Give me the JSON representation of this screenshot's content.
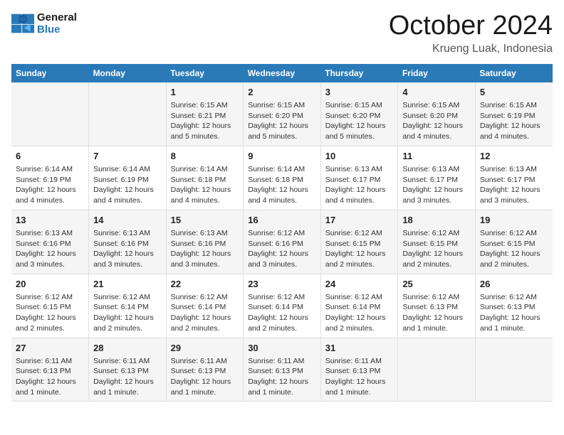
{
  "logo": {
    "line1": "General",
    "line2": "Blue"
  },
  "title": "October 2024",
  "location": "Krueng Luak, Indonesia",
  "weekdays": [
    "Sunday",
    "Monday",
    "Tuesday",
    "Wednesday",
    "Thursday",
    "Friday",
    "Saturday"
  ],
  "weeks": [
    [
      {
        "day": "",
        "info": ""
      },
      {
        "day": "",
        "info": ""
      },
      {
        "day": "1",
        "info": "Sunrise: 6:15 AM\nSunset: 6:21 PM\nDaylight: 12 hours and 5 minutes."
      },
      {
        "day": "2",
        "info": "Sunrise: 6:15 AM\nSunset: 6:20 PM\nDaylight: 12 hours and 5 minutes."
      },
      {
        "day": "3",
        "info": "Sunrise: 6:15 AM\nSunset: 6:20 PM\nDaylight: 12 hours and 5 minutes."
      },
      {
        "day": "4",
        "info": "Sunrise: 6:15 AM\nSunset: 6:20 PM\nDaylight: 12 hours and 4 minutes."
      },
      {
        "day": "5",
        "info": "Sunrise: 6:15 AM\nSunset: 6:19 PM\nDaylight: 12 hours and 4 minutes."
      }
    ],
    [
      {
        "day": "6",
        "info": "Sunrise: 6:14 AM\nSunset: 6:19 PM\nDaylight: 12 hours and 4 minutes."
      },
      {
        "day": "7",
        "info": "Sunrise: 6:14 AM\nSunset: 6:19 PM\nDaylight: 12 hours and 4 minutes."
      },
      {
        "day": "8",
        "info": "Sunrise: 6:14 AM\nSunset: 6:18 PM\nDaylight: 12 hours and 4 minutes."
      },
      {
        "day": "9",
        "info": "Sunrise: 6:14 AM\nSunset: 6:18 PM\nDaylight: 12 hours and 4 minutes."
      },
      {
        "day": "10",
        "info": "Sunrise: 6:13 AM\nSunset: 6:17 PM\nDaylight: 12 hours and 4 minutes."
      },
      {
        "day": "11",
        "info": "Sunrise: 6:13 AM\nSunset: 6:17 PM\nDaylight: 12 hours and 3 minutes."
      },
      {
        "day": "12",
        "info": "Sunrise: 6:13 AM\nSunset: 6:17 PM\nDaylight: 12 hours and 3 minutes."
      }
    ],
    [
      {
        "day": "13",
        "info": "Sunrise: 6:13 AM\nSunset: 6:16 PM\nDaylight: 12 hours and 3 minutes."
      },
      {
        "day": "14",
        "info": "Sunrise: 6:13 AM\nSunset: 6:16 PM\nDaylight: 12 hours and 3 minutes."
      },
      {
        "day": "15",
        "info": "Sunrise: 6:13 AM\nSunset: 6:16 PM\nDaylight: 12 hours and 3 minutes."
      },
      {
        "day": "16",
        "info": "Sunrise: 6:12 AM\nSunset: 6:16 PM\nDaylight: 12 hours and 3 minutes."
      },
      {
        "day": "17",
        "info": "Sunrise: 6:12 AM\nSunset: 6:15 PM\nDaylight: 12 hours and 2 minutes."
      },
      {
        "day": "18",
        "info": "Sunrise: 6:12 AM\nSunset: 6:15 PM\nDaylight: 12 hours and 2 minutes."
      },
      {
        "day": "19",
        "info": "Sunrise: 6:12 AM\nSunset: 6:15 PM\nDaylight: 12 hours and 2 minutes."
      }
    ],
    [
      {
        "day": "20",
        "info": "Sunrise: 6:12 AM\nSunset: 6:15 PM\nDaylight: 12 hours and 2 minutes."
      },
      {
        "day": "21",
        "info": "Sunrise: 6:12 AM\nSunset: 6:14 PM\nDaylight: 12 hours and 2 minutes."
      },
      {
        "day": "22",
        "info": "Sunrise: 6:12 AM\nSunset: 6:14 PM\nDaylight: 12 hours and 2 minutes."
      },
      {
        "day": "23",
        "info": "Sunrise: 6:12 AM\nSunset: 6:14 PM\nDaylight: 12 hours and 2 minutes."
      },
      {
        "day": "24",
        "info": "Sunrise: 6:12 AM\nSunset: 6:14 PM\nDaylight: 12 hours and 2 minutes."
      },
      {
        "day": "25",
        "info": "Sunrise: 6:12 AM\nSunset: 6:13 PM\nDaylight: 12 hours and 1 minute."
      },
      {
        "day": "26",
        "info": "Sunrise: 6:12 AM\nSunset: 6:13 PM\nDaylight: 12 hours and 1 minute."
      }
    ],
    [
      {
        "day": "27",
        "info": "Sunrise: 6:11 AM\nSunset: 6:13 PM\nDaylight: 12 hours and 1 minute."
      },
      {
        "day": "28",
        "info": "Sunrise: 6:11 AM\nSunset: 6:13 PM\nDaylight: 12 hours and 1 minute."
      },
      {
        "day": "29",
        "info": "Sunrise: 6:11 AM\nSunset: 6:13 PM\nDaylight: 12 hours and 1 minute."
      },
      {
        "day": "30",
        "info": "Sunrise: 6:11 AM\nSunset: 6:13 PM\nDaylight: 12 hours and 1 minute."
      },
      {
        "day": "31",
        "info": "Sunrise: 6:11 AM\nSunset: 6:13 PM\nDaylight: 12 hours and 1 minute."
      },
      {
        "day": "",
        "info": ""
      },
      {
        "day": "",
        "info": ""
      }
    ]
  ]
}
